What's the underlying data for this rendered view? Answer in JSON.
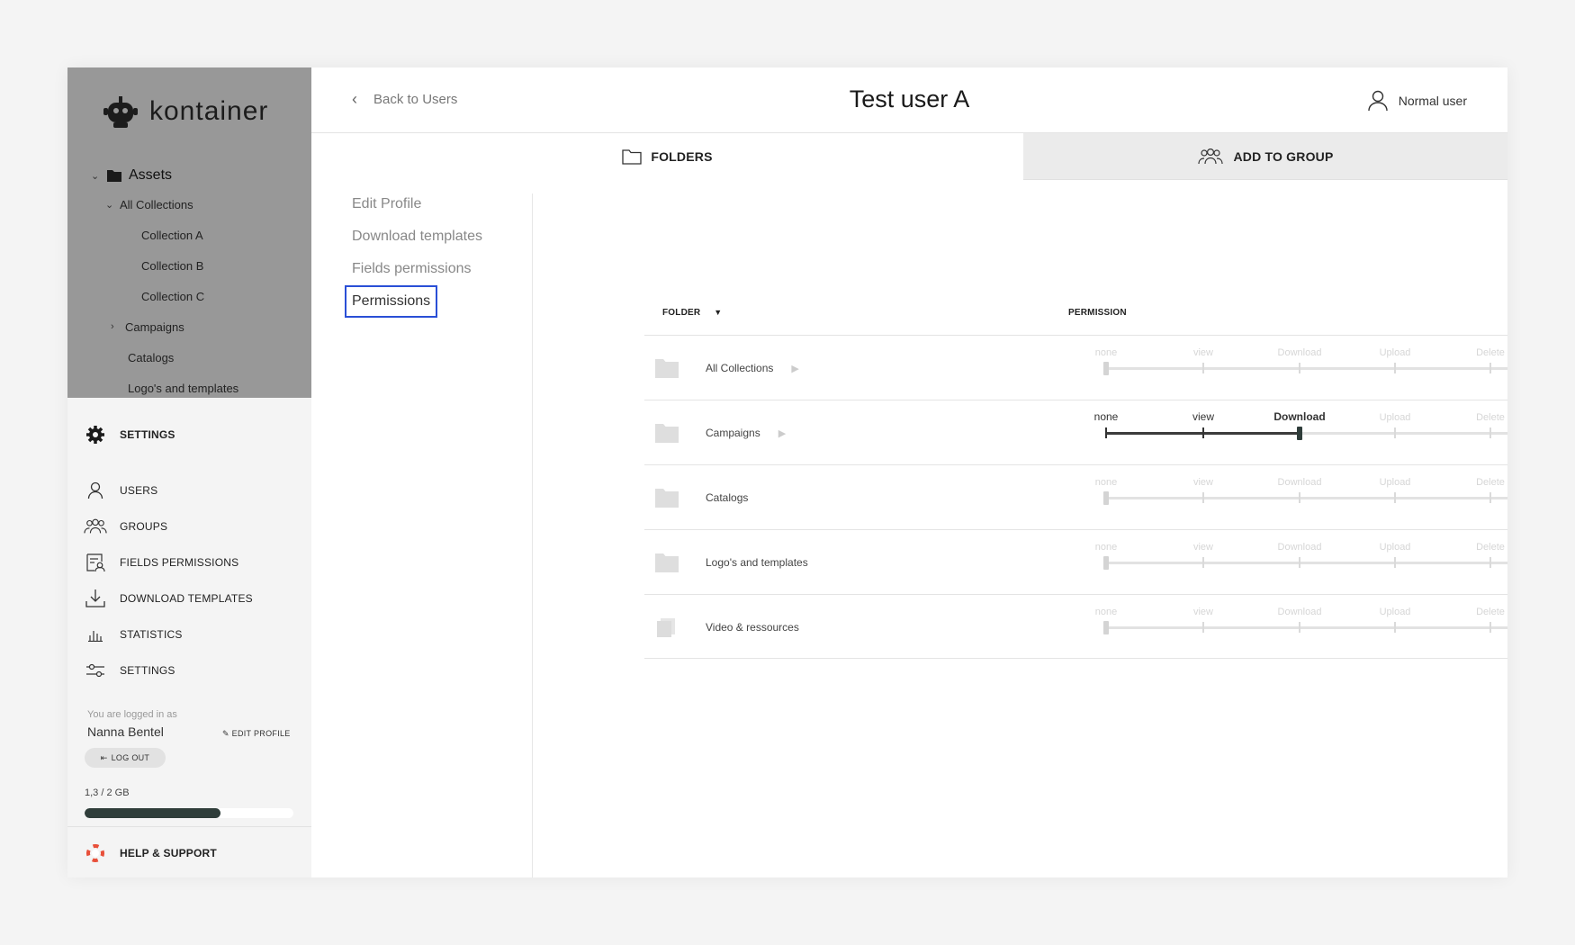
{
  "brand": {
    "name": "kontainer"
  },
  "tree": {
    "root": "Assets",
    "items": [
      {
        "label": "All Collections"
      },
      {
        "label": "Collection A"
      },
      {
        "label": "Collection B"
      },
      {
        "label": "Collection C"
      },
      {
        "label": "Campaigns"
      },
      {
        "label": "Catalogs"
      },
      {
        "label": "Logo's and templates"
      }
    ]
  },
  "sidebar": {
    "section_title": "SETTINGS",
    "nav": [
      {
        "label": "USERS",
        "icon": "user-icon"
      },
      {
        "label": "GROUPS",
        "icon": "group-icon"
      },
      {
        "label": "FIELDS PERMISSIONS",
        "icon": "fields-permissions-icon"
      },
      {
        "label": "DOWNLOAD TEMPLATES",
        "icon": "download-icon"
      },
      {
        "label": "STATISTICS",
        "icon": "statistics-icon"
      },
      {
        "label": "SETTINGS",
        "icon": "sliders-icon"
      }
    ],
    "logged_in_label": "You are logged in as",
    "user_name": "Nanna Bentel",
    "edit_profile": "EDIT PROFILE",
    "logout": "LOG OUT",
    "storage": {
      "label": "1,3 / 2 GB",
      "used_fraction": 0.65
    },
    "help": "HELP & SUPPORT"
  },
  "header": {
    "back": "Back to Users",
    "title": "Test user A",
    "user_type": "Normal user"
  },
  "tabs": [
    {
      "label": "FOLDERS",
      "active": true
    },
    {
      "label": "ADD TO GROUP",
      "active": false
    }
  ],
  "subnav": [
    {
      "label": "Edit Profile"
    },
    {
      "label": "Download templates"
    },
    {
      "label": "Fields permissions"
    },
    {
      "label": "Permissions",
      "active": true
    }
  ],
  "table": {
    "headers": {
      "folder": "FOLDER",
      "permission": "PERMISSION"
    },
    "levels": [
      "none",
      "view",
      "Download",
      "Upload",
      "Delete"
    ],
    "rows": [
      {
        "name": "All Collections",
        "expandable": true,
        "level": 0,
        "active": false
      },
      {
        "name": "Campaigns",
        "expandable": true,
        "level": 2,
        "active": true
      },
      {
        "name": "Catalogs",
        "expandable": false,
        "level": 0,
        "active": false
      },
      {
        "name": "Logo's and templates",
        "expandable": false,
        "level": 0,
        "active": false
      },
      {
        "name": "Video & ressources",
        "expandable": false,
        "level": 0,
        "active": false
      }
    ]
  },
  "colors": {
    "accent": "#2f3d3a",
    "focus": "#2a4fd6",
    "help_icon": "#e8503a"
  }
}
